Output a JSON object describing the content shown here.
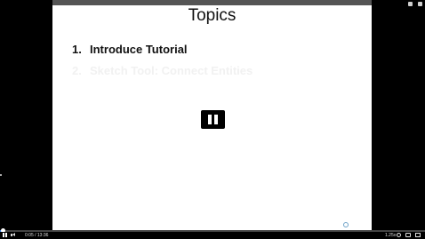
{
  "slide": {
    "title": "Topics",
    "topics": [
      {
        "number": "1.",
        "label": "Introduce Tutorial"
      },
      {
        "number": "2.",
        "label": "Sketch Tool: Connect Entities"
      }
    ]
  },
  "player": {
    "current_time": "0:05",
    "duration": "13:36",
    "speed": "1.25x",
    "progress_fraction": 0.006
  },
  "colors": {
    "progress_accent": "#3b7dd8",
    "slide_header_bar": "#555555"
  },
  "icons": {
    "pause_overlay": "pause-icon",
    "loader": "loading-icon",
    "play_pause": "pause-icon",
    "volume": "volume-icon",
    "settings": "gear-icon",
    "captions": "cc-icon",
    "fullscreen": "fullscreen-icon"
  }
}
